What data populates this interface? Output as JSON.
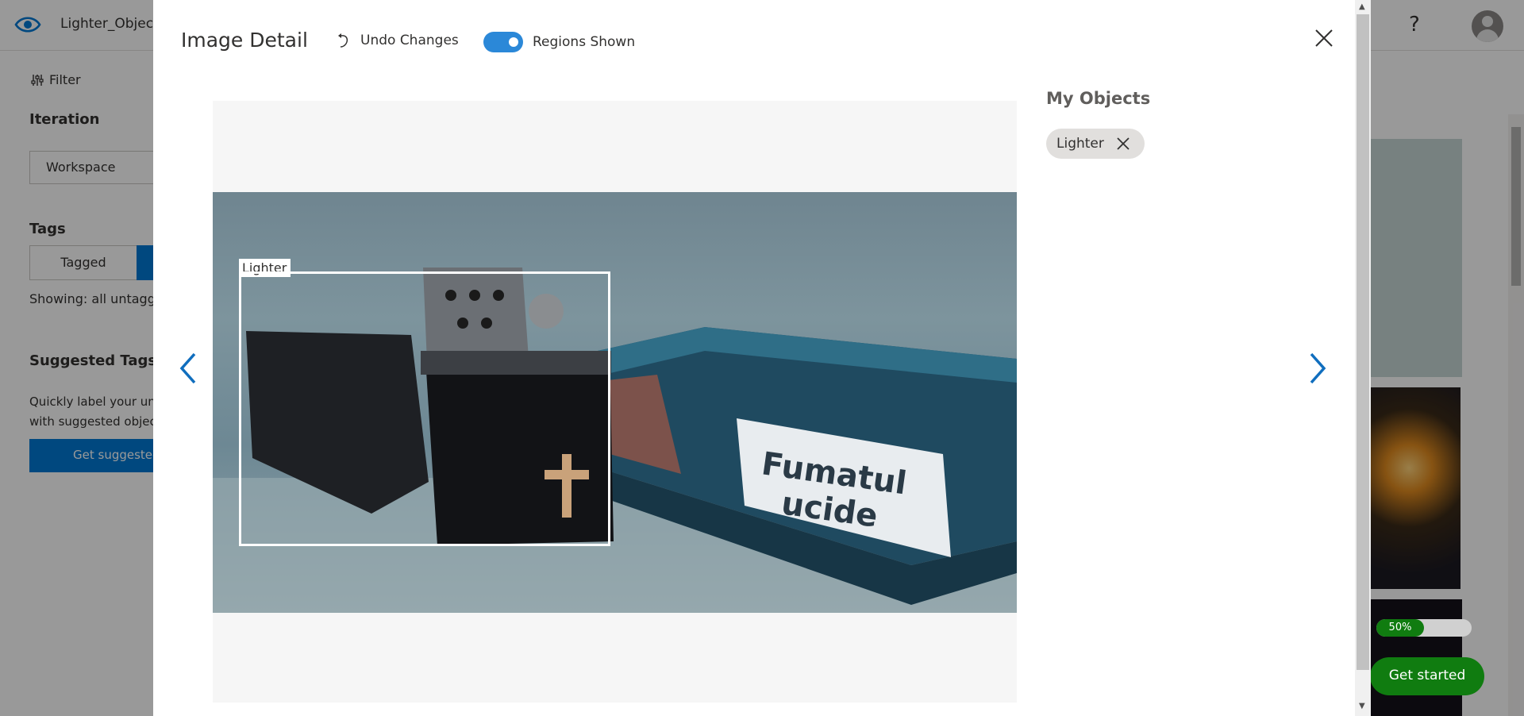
{
  "app": {
    "project_name": "Lighter_Object",
    "help_symbol": "?",
    "sidebar": {
      "filter_label": "Filter",
      "iteration_heading": "Iteration",
      "iteration_value": "Workspace",
      "tags_heading": "Tags",
      "tagged_label": "Tagged",
      "showing_text": "Showing: all untagg",
      "suggested_heading": "Suggested Tags",
      "suggested_line1": "Quickly label your unt",
      "suggested_line2": "with suggested object",
      "suggested_button": "Get suggested"
    },
    "progress_percent": 50,
    "progress_label": "50%",
    "get_started_label": "Get started"
  },
  "modal": {
    "title": "Image Detail",
    "undo_label": "Undo Changes",
    "toggle_label": "Regions Shown",
    "toggle_on": true,
    "region": {
      "tag": "Lighter"
    },
    "image_text_line1": "Fumatul",
    "image_text_line2": "ucide",
    "objects_heading": "My Objects",
    "objects": [
      {
        "label": "Lighter"
      }
    ]
  },
  "colors": {
    "accent": "#0078d4",
    "toggle": "#2b88d8",
    "success": "#107c10"
  },
  "icons": {
    "logo": "eye-icon",
    "undo": "undo-icon",
    "close": "close-icon",
    "prev": "chevron-left-icon",
    "next": "chevron-right-icon",
    "remove_tag": "close-icon",
    "filter": "filter-sliders-icon"
  }
}
